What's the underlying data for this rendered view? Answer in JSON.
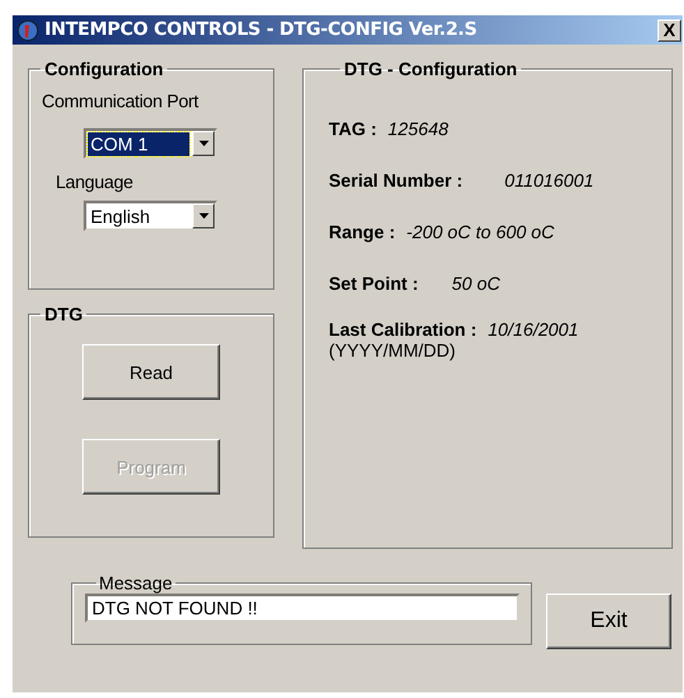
{
  "window": {
    "title": "INTEMPCO CONTROLS - DTG-CONFIG Ver.2.S",
    "close": "X"
  },
  "configuration": {
    "title": "Configuration",
    "port_label": "Communication Port",
    "port": {
      "value": "COM 1",
      "focused": true
    },
    "language_label": "Language",
    "language": {
      "value": "English",
      "focused": false
    }
  },
  "dtg": {
    "title": "DTG",
    "buttons": [
      {
        "label": "Read",
        "disabled": false
      },
      {
        "label": "Program",
        "disabled": true
      }
    ]
  },
  "dtg_configuration": {
    "title": "DTG - Configuration",
    "fields": [
      {
        "label": "TAG :",
        "value": "125648"
      },
      {
        "label": "Serial Number :",
        "value": "011016001"
      },
      {
        "label": "Range :",
        "value": "-200 oC to 600 oC"
      },
      {
        "label": "Set Point :",
        "value": "50 oC"
      },
      {
        "label": "Last Calibration :",
        "value": "10/16/2001",
        "note": "(YYYY/MM/DD)"
      }
    ]
  },
  "message": {
    "title": "Message",
    "value": "DTG NOT FOUND !!"
  },
  "exit_button": "Exit"
}
